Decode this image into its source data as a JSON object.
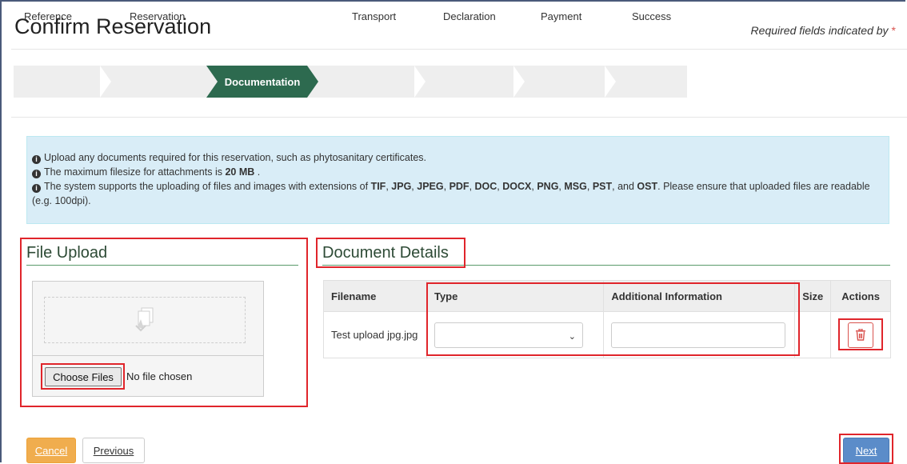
{
  "header": {
    "title": "Confirm Reservation",
    "required_text": "Required fields indicated by",
    "required_star": "*"
  },
  "wizard": {
    "steps": [
      "Reference",
      "Reservation",
      "Documentation",
      "Transport",
      "Declaration",
      "Payment",
      "Success"
    ],
    "active_index": 2,
    "active_color": "#2d6a4f"
  },
  "info": {
    "line1": "Upload any documents required for this reservation, such as phytosanitary certificates.",
    "line2_prefix": "The maximum filesize for attachments is",
    "line2_value": "20 MB",
    "line2_suffix": ".",
    "line3_prefix": "The system supports the uploading of files and images with extensions of",
    "extensions": [
      "TIF",
      "JPG",
      "JPEG",
      "PDF",
      "DOC",
      "DOCX",
      "PNG",
      "MSG",
      "PST"
    ],
    "ext_last": "OST",
    "and_text": "and",
    "line3_suffix": ". Please ensure that uploaded files are readable (e.g. 100dpi)."
  },
  "file_upload": {
    "title": "File Upload",
    "choose_label": "Choose Files",
    "status": "No file chosen"
  },
  "document_details": {
    "title": "Document Details",
    "columns": [
      "Filename",
      "Type",
      "Additional Information",
      "Size",
      "Actions"
    ],
    "rows": [
      {
        "filename": "Test upload jpg.jpg",
        "type": "",
        "additional_info": "",
        "size": ""
      }
    ]
  },
  "footer": {
    "cancel_label": "Cancel",
    "previous_label": "Previous",
    "next_label": "Next"
  },
  "colors": {
    "accent_green": "#2d6a4f",
    "annotation_red": "#e0252b",
    "next_blue": "#5b8cc9",
    "cancel_orange": "#f0ad4e",
    "info_bg": "#d9edf7"
  }
}
